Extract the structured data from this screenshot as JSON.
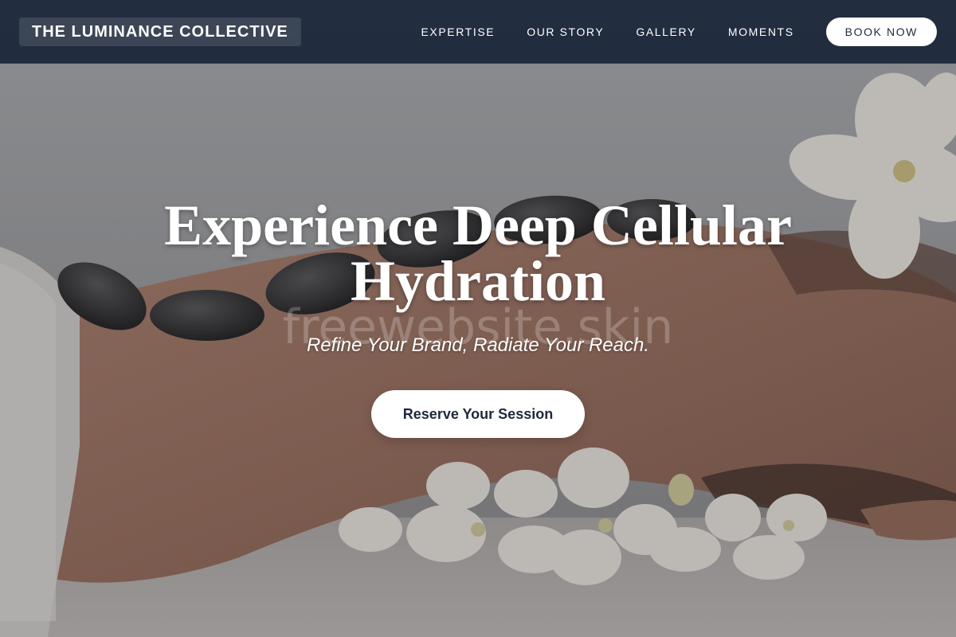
{
  "header": {
    "brand": "THE LUMINANCE COLLECTIVE",
    "nav": [
      {
        "label": "EXPERTISE"
      },
      {
        "label": "OUR STORY"
      },
      {
        "label": "GALLERY"
      },
      {
        "label": "MOMENTS"
      }
    ],
    "cta_label": "BOOK NOW"
  },
  "hero": {
    "title": "Experience Deep Cellular Hydration",
    "watermark": "freewebsite.skin",
    "subtitle": "Refine Your Brand, Radiate Your Reach.",
    "button_label": "Reserve Your Session"
  },
  "colors": {
    "header_bg": "#1e293b",
    "button_bg": "#ffffff",
    "button_text": "#1e293b",
    "text_light": "#ffffff"
  },
  "icons": {
    "hero_image": "spa-massage-hot-stones-orchids-photo"
  }
}
